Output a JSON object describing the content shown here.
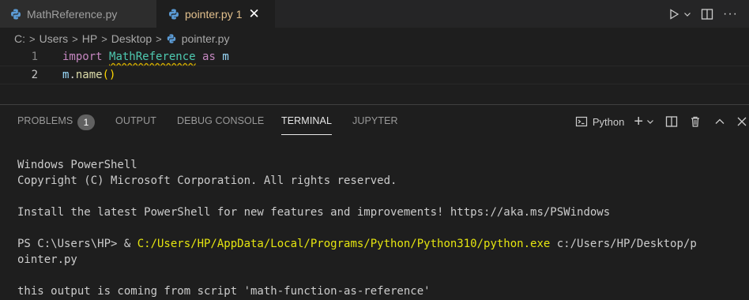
{
  "tabs": [
    {
      "label": "MathReference.py",
      "active": false
    },
    {
      "label": "pointer.py",
      "problems": "1",
      "active": true
    }
  ],
  "breadcrumb": [
    "C:",
    "Users",
    "HP",
    "Desktop",
    "pointer.py"
  ],
  "editor": {
    "lines": [
      {
        "number": "1",
        "kw": "import",
        "module": "MathReference",
        "as_kw": "as",
        "alias": "m"
      },
      {
        "number": "2",
        "obj": "m",
        "dot": ".",
        "fn": "name",
        "parens": "()"
      }
    ]
  },
  "panel": {
    "tabs": [
      "PROBLEMS",
      "OUTPUT",
      "DEBUG CONSOLE",
      "TERMINAL",
      "JUPYTER"
    ],
    "problems_count": "1",
    "terminal_profile": "Python"
  },
  "terminal": {
    "line1": "Windows PowerShell",
    "line2": "Copyright (C) Microsoft Corporation. All rights reserved.",
    "line3": "Install the latest PowerShell for new features and improvements! https://aka.ms/PSWindows",
    "prompt": "PS C:\\Users\\HP> & ",
    "python_path": "C:/Users/HP/AppData/Local/Programs/Python/Python310/python.exe",
    "script_arg": " c:/Users/HP/Desktop/p",
    "script_arg_wrap": "ointer.py",
    "output": "this output is coming from script 'math-function-as-reference'"
  },
  "colors": {
    "accent_modified": "#e2c08d",
    "terminal_yellow": "#e5e510",
    "keyword": "#c586c0",
    "module": "#4ec9b0"
  }
}
